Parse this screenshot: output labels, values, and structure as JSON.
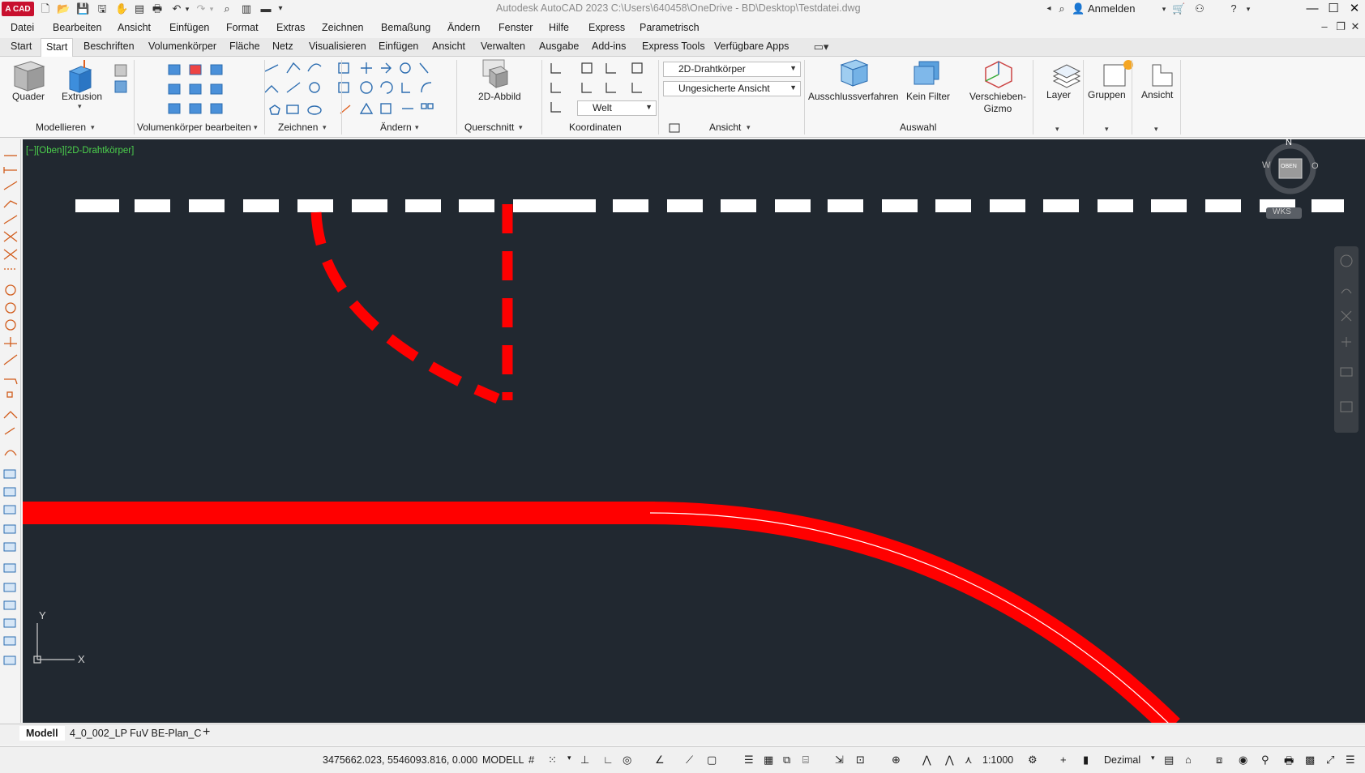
{
  "titlebar": {
    "logo": "A CAD",
    "title": "Autodesk AutoCAD 2023    C:\\Users\\640458\\OneDrive - BD\\Desktop\\Testdatei.dwg",
    "signin": "Anmelden"
  },
  "menubar": [
    "Datei",
    "Bearbeiten",
    "Ansicht",
    "Einfügen",
    "Format",
    "Extras",
    "Zeichnen",
    "Bemaßung",
    "Ändern",
    "Fenster",
    "Hilfe",
    "Express",
    "Parametrisch"
  ],
  "ribbon_tabs": [
    "Start",
    "Start",
    "Beschriften",
    "Volumenkörper",
    "Fläche",
    "Netz",
    "Visualisieren",
    "Einfügen",
    "Ansicht",
    "Verwalten",
    "Ausgabe",
    "Add-ins",
    "Express Tools",
    "Verfügbare Apps"
  ],
  "ribbon": {
    "buttons": {
      "quader": "Quader",
      "extrusion": "Extrusion",
      "abbild": "2D-Abbild",
      "ausschluss": "Ausschlussverfahren",
      "kein_filter": "Kein Filter",
      "gizmo": "Verschieben-Gizmo",
      "layer": "Layer",
      "gruppen": "Gruppen",
      "ansicht": "Ansicht"
    },
    "panels": {
      "modellieren": "Modellieren",
      "volumen": "Volumenkörper bearbeiten",
      "zeichnen": "Zeichnen",
      "aendern": "Ändern",
      "querschnitt": "Querschnitt",
      "koordinaten": "Koordinaten",
      "ansicht": "Ansicht",
      "auswahl": "Auswahl"
    },
    "combos": {
      "visual_style": "2D-Drahtkörper",
      "named_view": "Ungesicherte Ansicht",
      "ucs": "Welt"
    }
  },
  "viewport": {
    "label": "[−][Oben][2D-Drahtkörper]",
    "viewcube": {
      "top": "OBEN",
      "north": "N",
      "west": "W",
      "east": "O",
      "wcs": "WKS"
    },
    "ucs_x": "X",
    "ucs_y": "Y"
  },
  "layout_tabs": [
    "Modell",
    "4_0_002_LP FuV BE-Plan_C",
    "+"
  ],
  "statusbar": {
    "coords": "3475662.023, 5546093.816, 0.000",
    "mode": "MODELL",
    "scale": "1:1000",
    "units": "Dezimal"
  },
  "colors": {
    "canvas": "#212830",
    "red_line": "#ff0000",
    "white_line": "#ffffff",
    "viewport_label": "#4cd14c"
  }
}
